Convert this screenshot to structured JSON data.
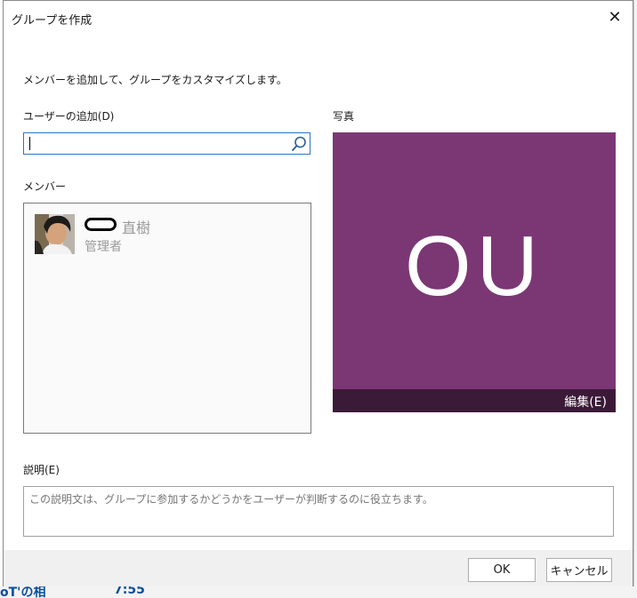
{
  "dialog": {
    "title": "グループを作成",
    "close_glyph": "✕",
    "instruction": "メンバーを追加して、グループをカスタマイズします。"
  },
  "add_user": {
    "label": "ユーザーの追加(D)",
    "value": "",
    "icon": "search-icon"
  },
  "members": {
    "label": "メンバー",
    "items": [
      {
        "name": "直樹",
        "role": "管理者",
        "avatar": "avatar-photo"
      }
    ]
  },
  "photo": {
    "label": "写真",
    "initials": "OU",
    "edit_label": "編集(E)",
    "background_color": "#7b3774",
    "edit_bar_color": "#3b1a38"
  },
  "description": {
    "label": "説明(E)",
    "placeholder": "この説明文は、グループに参加するかどうかをユーザーが判断するのに役立ちます。",
    "value": ""
  },
  "buttons": {
    "ok": "OK",
    "cancel": "キャンセル"
  },
  "background": {
    "fragment_left": "oT'の相",
    "fragment_time": "7:55"
  }
}
